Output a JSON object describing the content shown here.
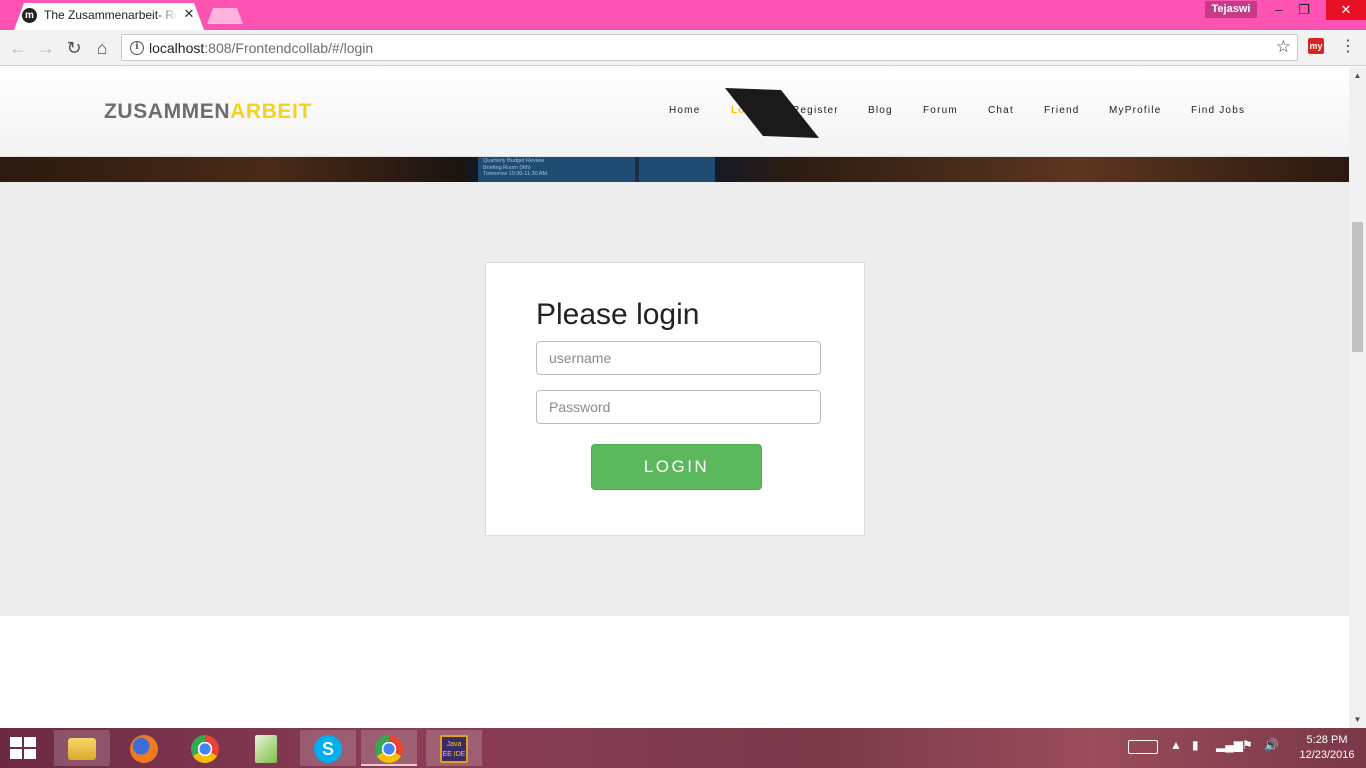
{
  "browser": {
    "tab_title": "The Zusammenarbeit- Re",
    "tab_favicon": "m",
    "profile_name": "Tejaswi",
    "url_host": "localhost",
    "url_rest": ":808/Frontendcollab/#/login",
    "extension_label": "my"
  },
  "site": {
    "logo_part1": "ZUSAMMEN",
    "logo_part2": "ARBEIT",
    "nav": {
      "home": "Home",
      "login": "Login",
      "register": "Register",
      "blog": "Blog",
      "forum": "Forum",
      "chat": "Chat",
      "friend": "Friend",
      "myprofile": "MyProfile",
      "find_jobs": "Find Jobs"
    },
    "hero_text": [
      "Quarterly Budget Review",
      "Briefing Room (9th)",
      "Tomorrow 10:30-11:30 AM"
    ]
  },
  "login": {
    "title": "Please login",
    "username_placeholder": "username",
    "password_placeholder": "Password",
    "button": "LOGIN"
  },
  "taskbar": {
    "java_ee_label": "Java EE IDE",
    "time": "5:28 PM",
    "date": "12/23/2016"
  },
  "colors": {
    "titlebar": "#ff53b3",
    "logo_accent": "#f4d21e",
    "active_nav": "#f4c20d",
    "login_button": "#5cb85c",
    "content_bg": "#ededed"
  }
}
